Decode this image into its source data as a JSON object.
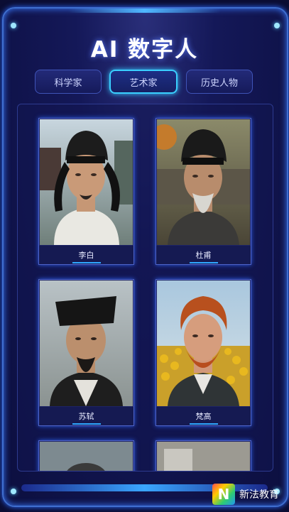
{
  "page": {
    "title": "AI 数字人"
  },
  "tabs": [
    {
      "label": "科学家",
      "active": false
    },
    {
      "label": "艺术家",
      "active": true
    },
    {
      "label": "历史人物",
      "active": false
    }
  ],
  "cards": [
    {
      "name": "李白",
      "icon": "portrait-li-bai"
    },
    {
      "name": "杜甫",
      "icon": "portrait-du-fu"
    },
    {
      "name": "苏轼",
      "icon": "portrait-su-shi"
    },
    {
      "name": "梵高",
      "icon": "portrait-van-gogh"
    }
  ],
  "watermark": {
    "logo": "N",
    "text": "新法教育"
  },
  "colors": {
    "accent": "#3ad0ff",
    "frame": "#3f6fd0",
    "background": "#0b0d33"
  }
}
